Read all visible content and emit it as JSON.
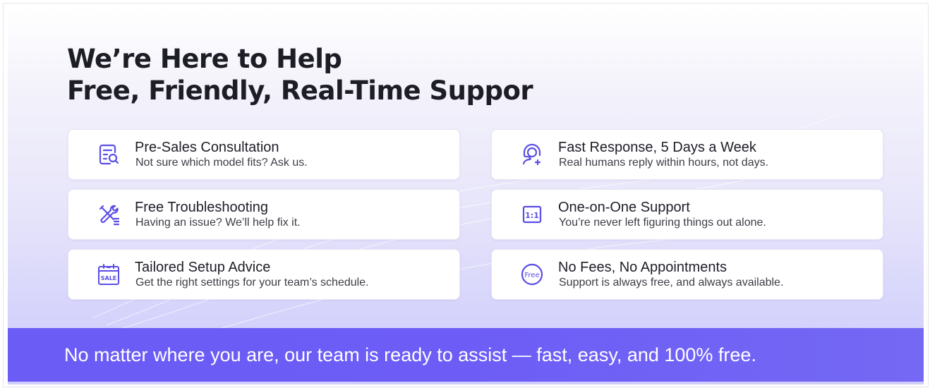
{
  "header": {
    "line1": "We’re Here to Help",
    "line2": "Free, Friendly, Real-Time Suppor"
  },
  "cards": [
    {
      "title": "Pre-Sales Consultation",
      "desc": "Not sure which model fits? Ask us.",
      "icon": "document-search-icon"
    },
    {
      "title": "Fast Response, 5 Days a Week",
      "desc": "Real humans reply within hours, not days.",
      "icon": "agent-headset-icon"
    },
    {
      "title": "Free Troubleshooting",
      "desc": "Having an issue? We’ll help fix it.",
      "icon": "tools-icon"
    },
    {
      "title": "One-on-One Support",
      "desc": "You’re never left figuring things out alone.",
      "icon": "one-to-one-icon",
      "icon_text": "1:1"
    },
    {
      "title": "Tailored Setup Advice",
      "desc": "Get the right settings for your team’s schedule.",
      "icon": "calendar-sale-icon",
      "icon_text": "SALE"
    },
    {
      "title": "No Fees, No Appointments",
      "desc": "Support is always free, and always available.",
      "icon": "free-badge-icon",
      "icon_text": "Free"
    }
  ],
  "banner": {
    "text": "No matter where you are, our team is ready to assist — fast, easy, and 100% free."
  },
  "colors": {
    "accent": "#6b5cf6",
    "icon": "#5b4ee6",
    "heading": "#1d1d26"
  }
}
